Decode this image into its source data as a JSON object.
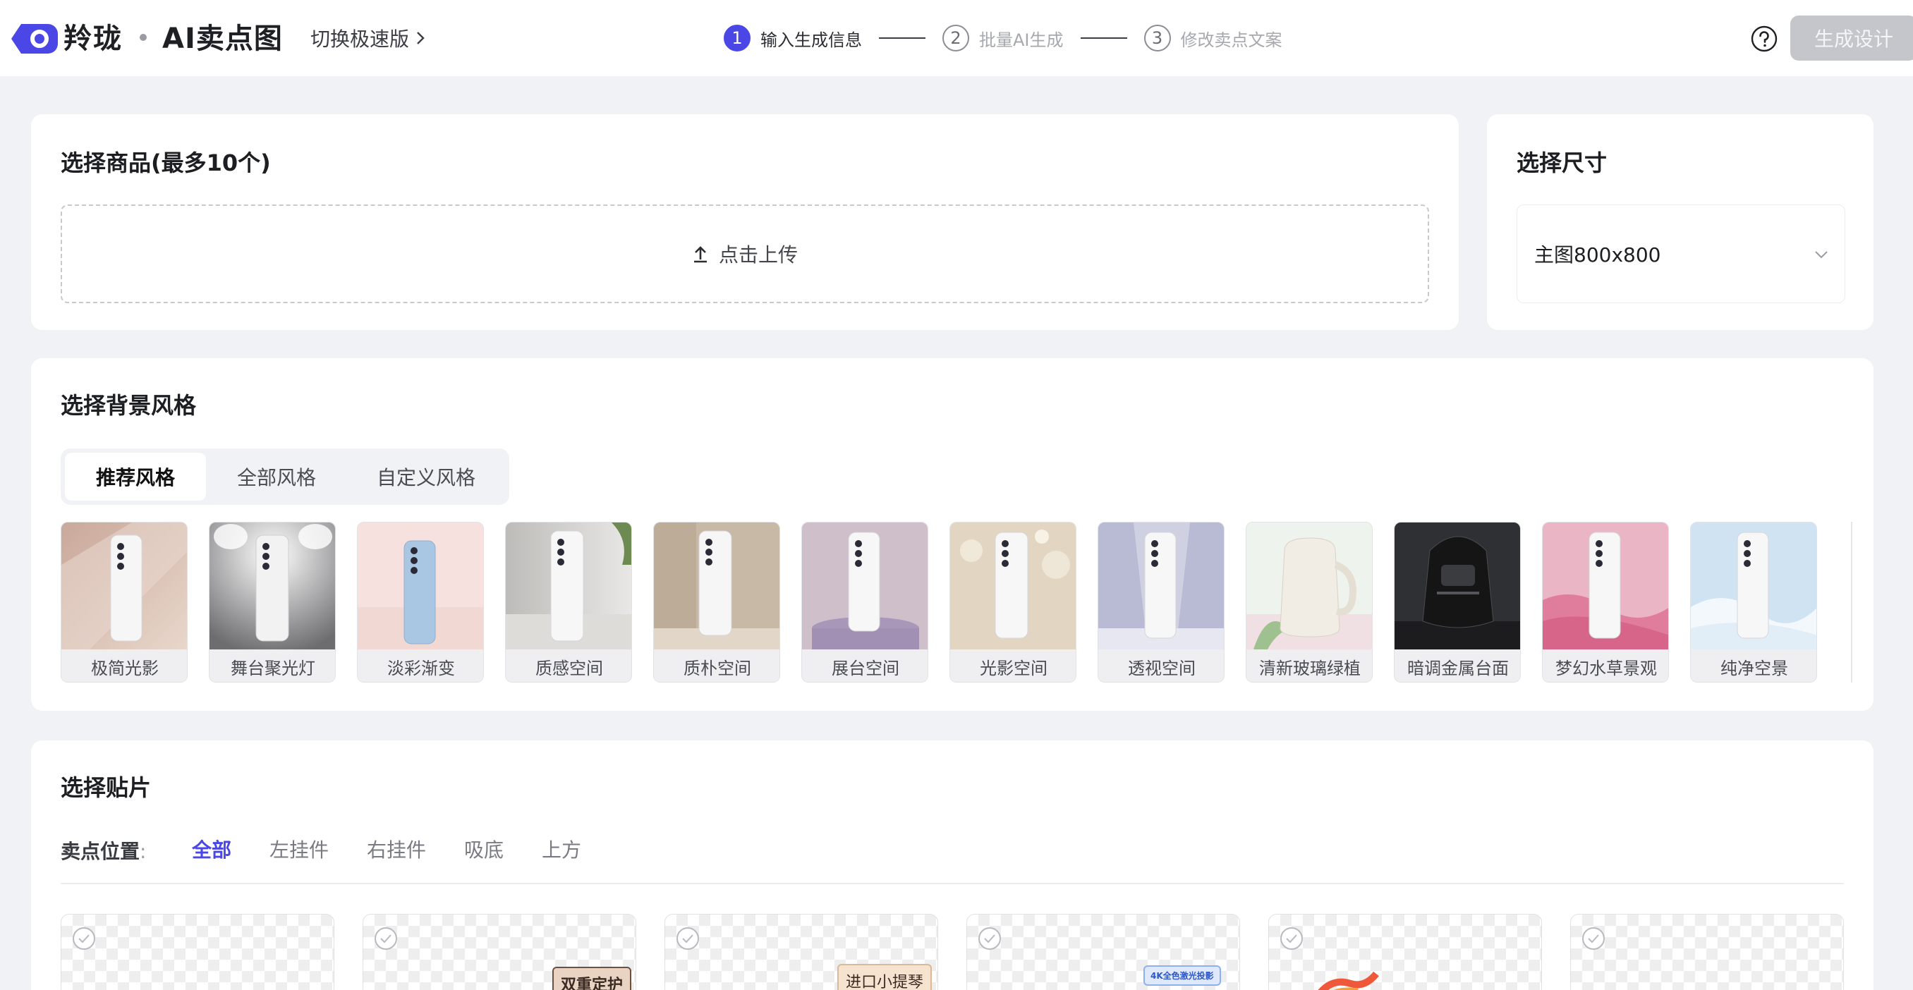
{
  "header": {
    "brand_name": "羚珑",
    "product_name": "AI卖点图",
    "switch_label": "切换极速版",
    "steps": [
      {
        "num": "1",
        "label": "输入生成信息"
      },
      {
        "num": "2",
        "label": "批量AI生成"
      },
      {
        "num": "3",
        "label": "修改卖点文案"
      }
    ],
    "generate_button": "生成设计",
    "colors": {
      "accent": "#4b47e6",
      "button_disabled": "#c4c6cc"
    }
  },
  "upload": {
    "title": "选择商品(最多10个)",
    "upload_label": "点击上传"
  },
  "size": {
    "title": "选择尺寸",
    "selected": "主图800x800"
  },
  "style": {
    "title": "选择背景风格",
    "tabs": [
      "推荐风格",
      "全部风格",
      "自定义风格"
    ],
    "items": [
      "极简光影",
      "舞台聚光灯",
      "淡彩渐变",
      "质感空间",
      "质朴空间",
      "展台空间",
      "光影空间",
      "透视空间",
      "清新玻璃绿植",
      "暗调金属台面",
      "梦幻水草景观",
      "纯净空景"
    ]
  },
  "stickers": {
    "title": "选择贴片",
    "filter_label": "卖点位置",
    "filter_colon": ":",
    "filters": [
      "全部",
      "左挂件",
      "右挂件",
      "吸底",
      "上方"
    ],
    "tags": [
      "双重定护",
      "进口小提琴",
      "4K全色激光投影"
    ]
  }
}
